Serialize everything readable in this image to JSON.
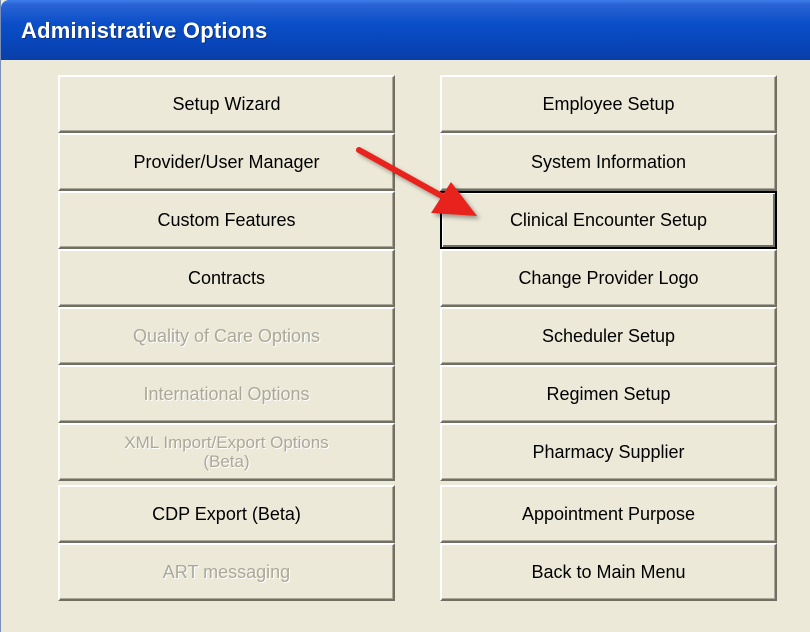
{
  "window": {
    "title": "Administrative Options"
  },
  "buttons_left": [
    {
      "label": "Setup Wizard",
      "enabled": true
    },
    {
      "label": "Provider/User Manager",
      "enabled": true
    },
    {
      "label": "Custom Features",
      "enabled": true
    },
    {
      "label": "Contracts",
      "enabled": true
    },
    {
      "label": "Quality of Care Options",
      "enabled": false
    },
    {
      "label": "International Options",
      "enabled": false
    },
    {
      "label": "XML Import/Export Options (Beta)",
      "enabled": false
    },
    {
      "label": "CDP Export (Beta)",
      "enabled": true
    },
    {
      "label": "ART messaging",
      "enabled": false
    }
  ],
  "buttons_right": [
    {
      "label": "Employee Setup",
      "enabled": true
    },
    {
      "label": "System Information",
      "enabled": true
    },
    {
      "label": "Clinical Encounter Setup",
      "enabled": true,
      "focused": true
    },
    {
      "label": "Change Provider Logo",
      "enabled": true
    },
    {
      "label": "Scheduler Setup",
      "enabled": true
    },
    {
      "label": "Regimen Setup",
      "enabled": true
    },
    {
      "label": "Pharmacy Supplier",
      "enabled": true
    },
    {
      "label": "Appointment Purpose",
      "enabled": true
    },
    {
      "label": "Back to Main Menu",
      "enabled": true
    }
  ],
  "annotation": {
    "type": "arrow",
    "color": "#e8211a",
    "points_to": "Clinical Encounter Setup"
  }
}
